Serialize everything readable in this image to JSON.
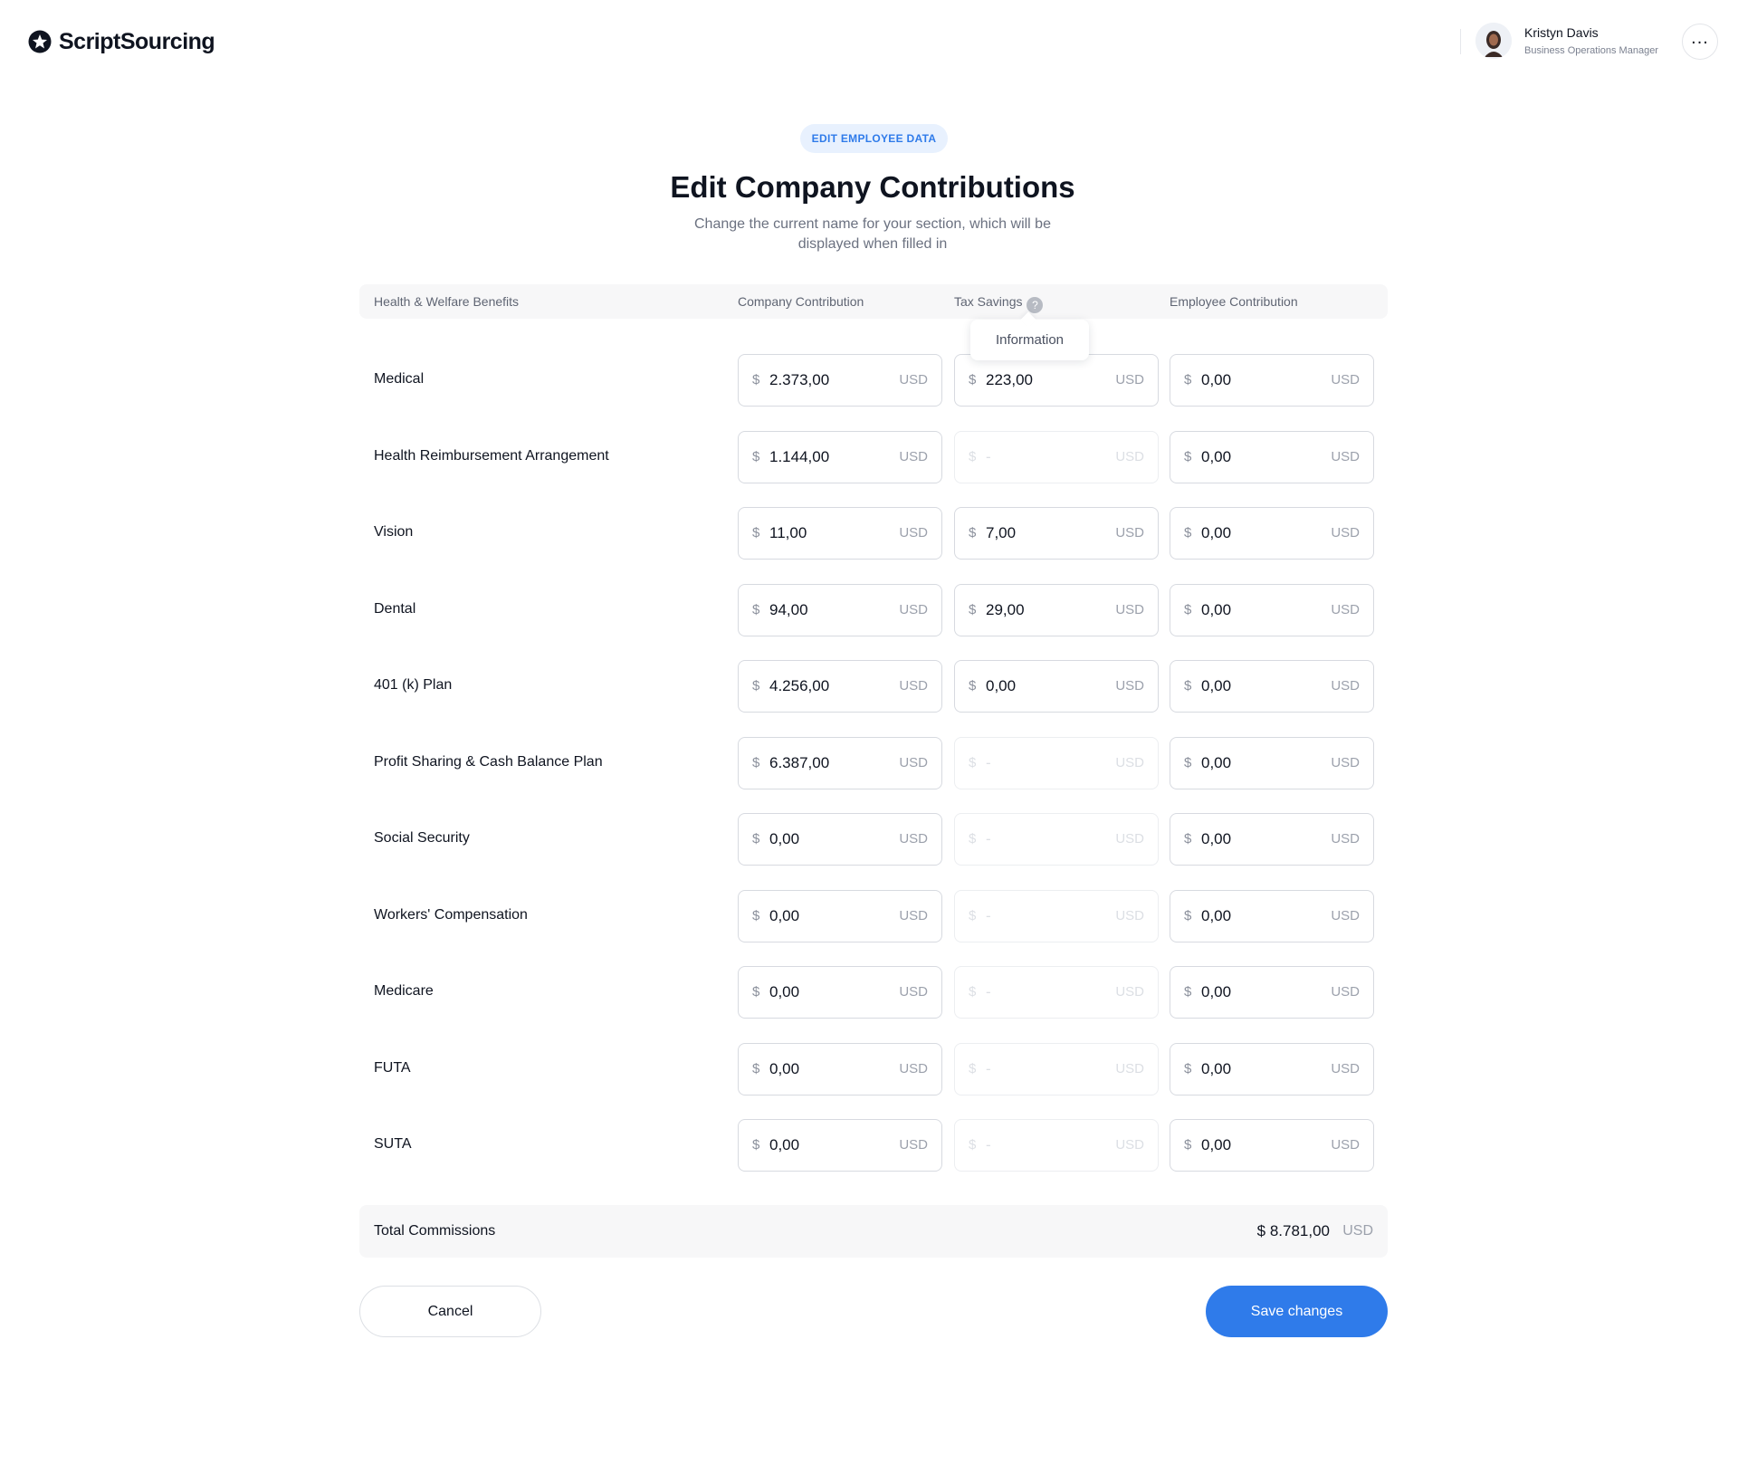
{
  "header": {
    "logo_text": "ScriptSourcing",
    "user_name": "Kristyn Davis",
    "user_role": "Business Operations Manager",
    "more_label": "..."
  },
  "page": {
    "pill": "EDIT EMPLOYEE DATA",
    "title": "Edit Company Contributions",
    "subtitle": "Change the current name for your section, which will be displayed when filled in"
  },
  "table": {
    "headers": [
      "Health & Welfare Benefits",
      "Company Contribution",
      "Tax Savings",
      "Employee Contribution"
    ],
    "info_icon_glyph": "?",
    "tooltip": "Information",
    "currency_symbol": "$",
    "currency_code": "USD",
    "disabled_placeholder": "-",
    "rows": [
      {
        "label": "Medical",
        "company": "2.373,00",
        "tax": "223,00",
        "tax_disabled": false,
        "employee": "0,00"
      },
      {
        "label": "Health Reimbursement Arrangement",
        "company": "1.144,00",
        "tax": "-",
        "tax_disabled": true,
        "employee": "0,00"
      },
      {
        "label": "Vision",
        "company": "11,00",
        "tax": "7,00",
        "tax_disabled": false,
        "employee": "0,00"
      },
      {
        "label": "Dental",
        "company": "94,00",
        "tax": "29,00",
        "tax_disabled": false,
        "employee": "0,00"
      },
      {
        "label": "401 (k) Plan",
        "company": "4.256,00",
        "tax": "0,00",
        "tax_disabled": false,
        "employee": "0,00"
      },
      {
        "label": "Profit Sharing & Cash Balance Plan",
        "company": "6.387,00",
        "tax": "-",
        "tax_disabled": true,
        "employee": "0,00"
      },
      {
        "label": "Social Security",
        "company": "0,00",
        "tax": "-",
        "tax_disabled": true,
        "employee": "0,00"
      },
      {
        "label": "Workers' Compensation",
        "company": "0,00",
        "tax": "-",
        "tax_disabled": true,
        "employee": "0,00"
      },
      {
        "label": "Medicare",
        "company": "0,00",
        "tax": "-",
        "tax_disabled": true,
        "employee": "0,00"
      },
      {
        "label": "FUTA",
        "company": "0,00",
        "tax": "-",
        "tax_disabled": true,
        "employee": "0,00"
      },
      {
        "label": "SUTA",
        "company": "0,00",
        "tax": "-",
        "tax_disabled": true,
        "employee": "0,00"
      }
    ]
  },
  "total": {
    "label": "Total Commissions",
    "value": "$ 8.781,00",
    "currency": "USD"
  },
  "buttons": {
    "cancel": "Cancel",
    "save": "Save changes"
  },
  "colors": {
    "accent": "#2f7bea",
    "pill_bg": "#e8f1fe"
  }
}
